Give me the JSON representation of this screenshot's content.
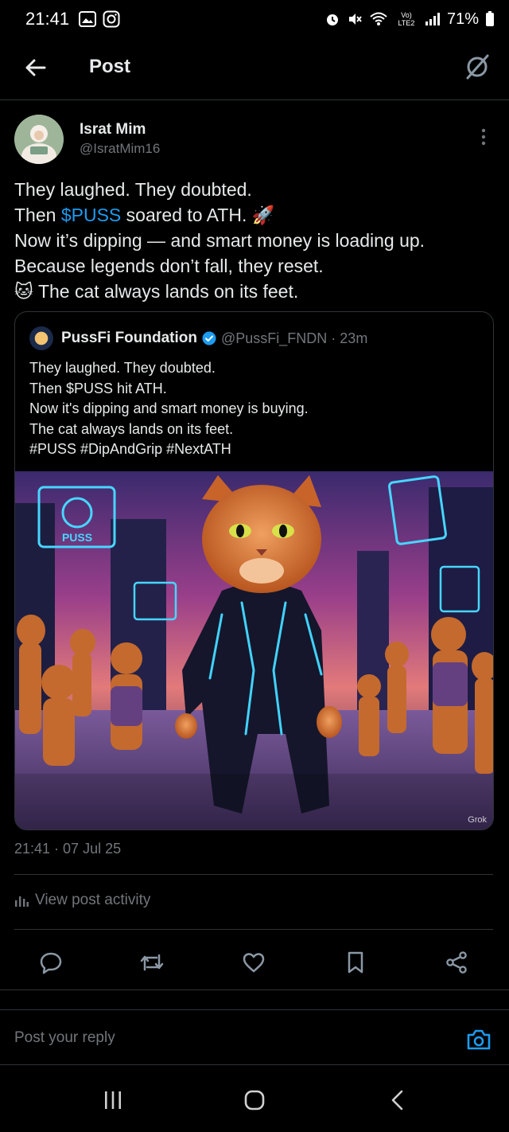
{
  "status_bar": {
    "time": "21:41",
    "network_label": "Vo) LTE2",
    "battery": "71%"
  },
  "header": {
    "title": "Post",
    "back_icon": "back-arrow-icon",
    "grok_icon": "grok-icon"
  },
  "author": {
    "name": "Israt Mim",
    "handle": "@IsratMim16"
  },
  "post": {
    "line1": "They laughed. They doubted.",
    "line2_prefix": "Then ",
    "line2_cashtag": "$PUSS",
    "line2_suffix": " soared to ATH. 🚀",
    "line3": "Now it’s dipping — and smart money is loading up.",
    "line4": "Because legends don’t fall, they reset.",
    "line5": "🐱 The cat always lands on its feet."
  },
  "quote": {
    "name": "PussFi Foundation",
    "handle": "@PussFi_FNDN",
    "separator": "·",
    "age": "23m",
    "lines": [
      "They laughed. They doubted.",
      "Then $PUSS hit ATH.",
      "Now it's dipping and smart money is buying.",
      "The cat always lands on its feet.",
      "#PUSS #DipAndGrip #NextATH"
    ],
    "image_sign_text": "PUSS",
    "watermark": "Grok"
  },
  "timestamp": "21:41 · 07 Jul 25",
  "activity_label": "View post activity",
  "actions": [
    "reply",
    "repost",
    "like",
    "bookmark",
    "share"
  ],
  "reply": {
    "placeholder": "Post your reply"
  },
  "colors": {
    "accent": "#1d9bf0",
    "background": "#000000",
    "secondary_text": "#71767b",
    "divider": "#2f3336"
  }
}
